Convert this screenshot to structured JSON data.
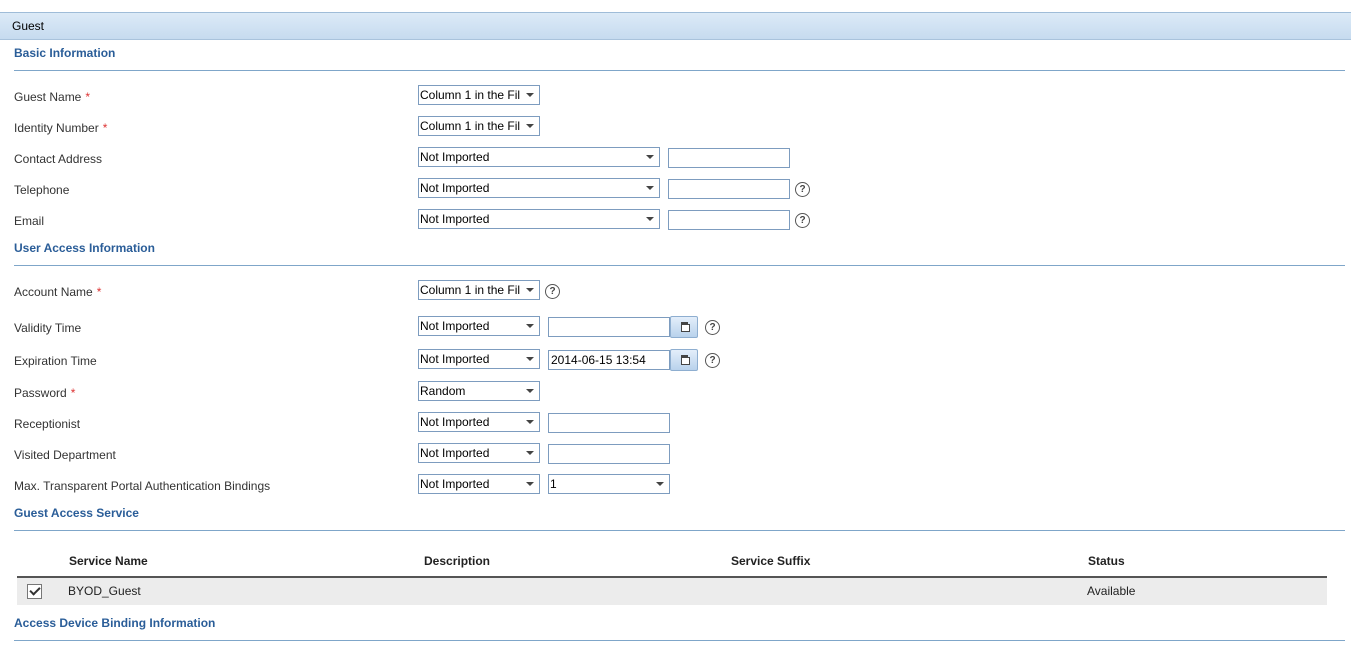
{
  "panel": {
    "title": "Guest"
  },
  "sections": {
    "basic": "Basic Information",
    "user_access": "User Access Information",
    "guest_service": "Guest Access Service",
    "device_binding": "Access Device Binding Information"
  },
  "required_marker": "*",
  "help_glyph": "?",
  "fields": {
    "guest_name": {
      "label": "Guest Name",
      "select": "Column 1 in the Fil"
    },
    "identity_number": {
      "label": "Identity Number",
      "select": "Column 1 in the Fil"
    },
    "contact_address": {
      "label": "Contact Address",
      "select": "Not Imported",
      "value": ""
    },
    "telephone": {
      "label": "Telephone",
      "select": "Not Imported",
      "value": ""
    },
    "email": {
      "label": "Email",
      "select": "Not Imported",
      "value": ""
    },
    "account_name": {
      "label": "Account Name",
      "select": "Column 1 in the Fil"
    },
    "validity_time": {
      "label": "Validity Time",
      "select": "Not Imported",
      "value": ""
    },
    "expiration_time": {
      "label": "Expiration Time",
      "select": "Not Imported",
      "value": "2014-06-15 13:54"
    },
    "password": {
      "label": "Password",
      "select": "Random"
    },
    "receptionist": {
      "label": "Receptionist",
      "select": "Not Imported",
      "value": ""
    },
    "visited_department": {
      "label": "Visited Department",
      "select": "Not Imported",
      "value": ""
    },
    "max_bindings": {
      "label": "Max. Transparent Portal Authentication Bindings",
      "select": "Not Imported",
      "value_select": "1"
    }
  },
  "service_table": {
    "columns": [
      "Service Name",
      "Description",
      "Service Suffix",
      "Status"
    ],
    "rows": [
      {
        "checked": true,
        "name": "BYOD_Guest",
        "description": "",
        "suffix": "",
        "status": "Available"
      }
    ]
  },
  "icons": {
    "help": "help-circle-icon",
    "calendar": "calendar-icon",
    "dropdown": "chevron-down-icon",
    "check": "checkmark-icon"
  }
}
